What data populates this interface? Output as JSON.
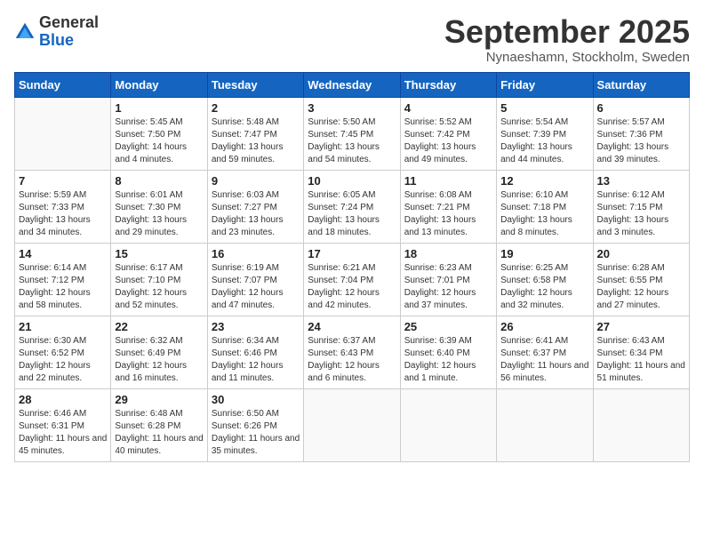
{
  "header": {
    "logo_general": "General",
    "logo_blue": "Blue",
    "month_title": "September 2025",
    "location": "Nynaeshamn, Stockholm, Sweden"
  },
  "weekdays": [
    "Sunday",
    "Monday",
    "Tuesday",
    "Wednesday",
    "Thursday",
    "Friday",
    "Saturday"
  ],
  "weeks": [
    [
      {
        "day": "",
        "sunrise": "",
        "sunset": "",
        "daylight": ""
      },
      {
        "day": "1",
        "sunrise": "Sunrise: 5:45 AM",
        "sunset": "Sunset: 7:50 PM",
        "daylight": "Daylight: 14 hours and 4 minutes."
      },
      {
        "day": "2",
        "sunrise": "Sunrise: 5:48 AM",
        "sunset": "Sunset: 7:47 PM",
        "daylight": "Daylight: 13 hours and 59 minutes."
      },
      {
        "day": "3",
        "sunrise": "Sunrise: 5:50 AM",
        "sunset": "Sunset: 7:45 PM",
        "daylight": "Daylight: 13 hours and 54 minutes."
      },
      {
        "day": "4",
        "sunrise": "Sunrise: 5:52 AM",
        "sunset": "Sunset: 7:42 PM",
        "daylight": "Daylight: 13 hours and 49 minutes."
      },
      {
        "day": "5",
        "sunrise": "Sunrise: 5:54 AM",
        "sunset": "Sunset: 7:39 PM",
        "daylight": "Daylight: 13 hours and 44 minutes."
      },
      {
        "day": "6",
        "sunrise": "Sunrise: 5:57 AM",
        "sunset": "Sunset: 7:36 PM",
        "daylight": "Daylight: 13 hours and 39 minutes."
      }
    ],
    [
      {
        "day": "7",
        "sunrise": "Sunrise: 5:59 AM",
        "sunset": "Sunset: 7:33 PM",
        "daylight": "Daylight: 13 hours and 34 minutes."
      },
      {
        "day": "8",
        "sunrise": "Sunrise: 6:01 AM",
        "sunset": "Sunset: 7:30 PM",
        "daylight": "Daylight: 13 hours and 29 minutes."
      },
      {
        "day": "9",
        "sunrise": "Sunrise: 6:03 AM",
        "sunset": "Sunset: 7:27 PM",
        "daylight": "Daylight: 13 hours and 23 minutes."
      },
      {
        "day": "10",
        "sunrise": "Sunrise: 6:05 AM",
        "sunset": "Sunset: 7:24 PM",
        "daylight": "Daylight: 13 hours and 18 minutes."
      },
      {
        "day": "11",
        "sunrise": "Sunrise: 6:08 AM",
        "sunset": "Sunset: 7:21 PM",
        "daylight": "Daylight: 13 hours and 13 minutes."
      },
      {
        "day": "12",
        "sunrise": "Sunrise: 6:10 AM",
        "sunset": "Sunset: 7:18 PM",
        "daylight": "Daylight: 13 hours and 8 minutes."
      },
      {
        "day": "13",
        "sunrise": "Sunrise: 6:12 AM",
        "sunset": "Sunset: 7:15 PM",
        "daylight": "Daylight: 13 hours and 3 minutes."
      }
    ],
    [
      {
        "day": "14",
        "sunrise": "Sunrise: 6:14 AM",
        "sunset": "Sunset: 7:12 PM",
        "daylight": "Daylight: 12 hours and 58 minutes."
      },
      {
        "day": "15",
        "sunrise": "Sunrise: 6:17 AM",
        "sunset": "Sunset: 7:10 PM",
        "daylight": "Daylight: 12 hours and 52 minutes."
      },
      {
        "day": "16",
        "sunrise": "Sunrise: 6:19 AM",
        "sunset": "Sunset: 7:07 PM",
        "daylight": "Daylight: 12 hours and 47 minutes."
      },
      {
        "day": "17",
        "sunrise": "Sunrise: 6:21 AM",
        "sunset": "Sunset: 7:04 PM",
        "daylight": "Daylight: 12 hours and 42 minutes."
      },
      {
        "day": "18",
        "sunrise": "Sunrise: 6:23 AM",
        "sunset": "Sunset: 7:01 PM",
        "daylight": "Daylight: 12 hours and 37 minutes."
      },
      {
        "day": "19",
        "sunrise": "Sunrise: 6:25 AM",
        "sunset": "Sunset: 6:58 PM",
        "daylight": "Daylight: 12 hours and 32 minutes."
      },
      {
        "day": "20",
        "sunrise": "Sunrise: 6:28 AM",
        "sunset": "Sunset: 6:55 PM",
        "daylight": "Daylight: 12 hours and 27 minutes."
      }
    ],
    [
      {
        "day": "21",
        "sunrise": "Sunrise: 6:30 AM",
        "sunset": "Sunset: 6:52 PM",
        "daylight": "Daylight: 12 hours and 22 minutes."
      },
      {
        "day": "22",
        "sunrise": "Sunrise: 6:32 AM",
        "sunset": "Sunset: 6:49 PM",
        "daylight": "Daylight: 12 hours and 16 minutes."
      },
      {
        "day": "23",
        "sunrise": "Sunrise: 6:34 AM",
        "sunset": "Sunset: 6:46 PM",
        "daylight": "Daylight: 12 hours and 11 minutes."
      },
      {
        "day": "24",
        "sunrise": "Sunrise: 6:37 AM",
        "sunset": "Sunset: 6:43 PM",
        "daylight": "Daylight: 12 hours and 6 minutes."
      },
      {
        "day": "25",
        "sunrise": "Sunrise: 6:39 AM",
        "sunset": "Sunset: 6:40 PM",
        "daylight": "Daylight: 12 hours and 1 minute."
      },
      {
        "day": "26",
        "sunrise": "Sunrise: 6:41 AM",
        "sunset": "Sunset: 6:37 PM",
        "daylight": "Daylight: 11 hours and 56 minutes."
      },
      {
        "day": "27",
        "sunrise": "Sunrise: 6:43 AM",
        "sunset": "Sunset: 6:34 PM",
        "daylight": "Daylight: 11 hours and 51 minutes."
      }
    ],
    [
      {
        "day": "28",
        "sunrise": "Sunrise: 6:46 AM",
        "sunset": "Sunset: 6:31 PM",
        "daylight": "Daylight: 11 hours and 45 minutes."
      },
      {
        "day": "29",
        "sunrise": "Sunrise: 6:48 AM",
        "sunset": "Sunset: 6:28 PM",
        "daylight": "Daylight: 11 hours and 40 minutes."
      },
      {
        "day": "30",
        "sunrise": "Sunrise: 6:50 AM",
        "sunset": "Sunset: 6:26 PM",
        "daylight": "Daylight: 11 hours and 35 minutes."
      },
      {
        "day": "",
        "sunrise": "",
        "sunset": "",
        "daylight": ""
      },
      {
        "day": "",
        "sunrise": "",
        "sunset": "",
        "daylight": ""
      },
      {
        "day": "",
        "sunrise": "",
        "sunset": "",
        "daylight": ""
      },
      {
        "day": "",
        "sunrise": "",
        "sunset": "",
        "daylight": ""
      }
    ]
  ]
}
